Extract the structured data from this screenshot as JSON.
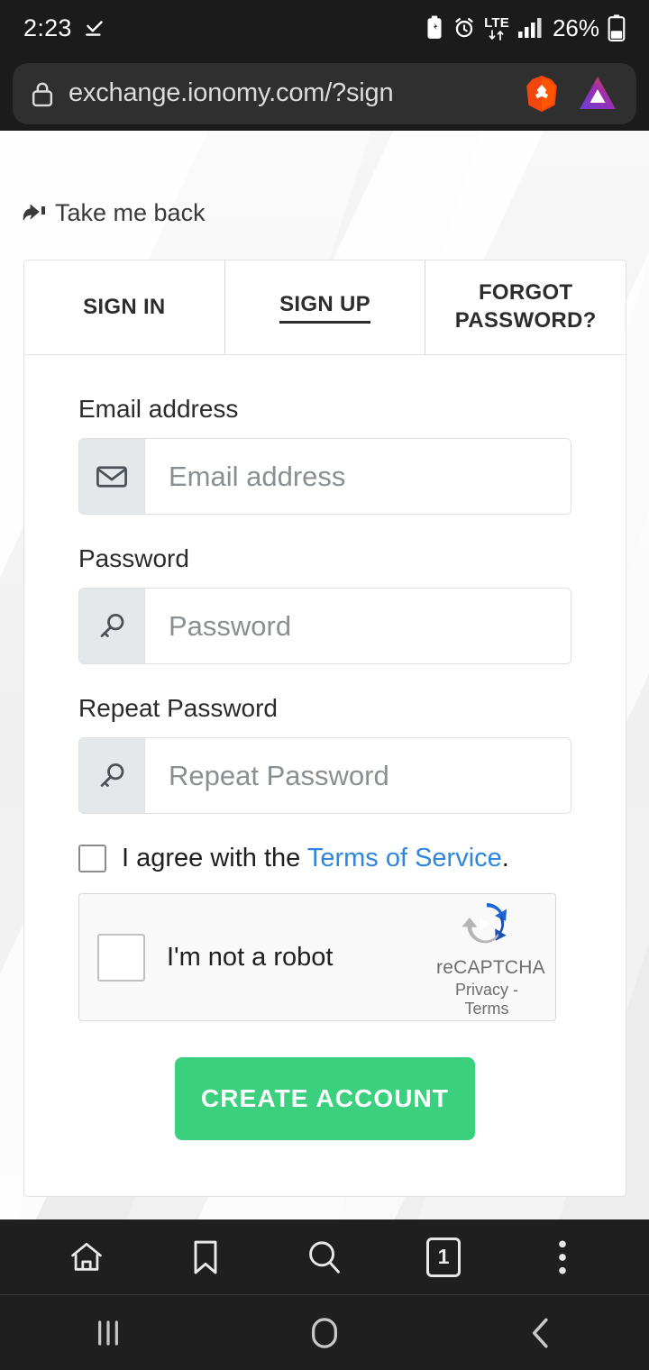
{
  "status_bar": {
    "time": "2:23",
    "battery_percent": "26%",
    "network_type": "LTE",
    "icons": [
      "check-download-icon",
      "battery-saver-icon",
      "alarm-icon",
      "lte-data-icon",
      "signal-bars-icon",
      "battery-icon"
    ]
  },
  "url_bar": {
    "url": "exchange.ionomy.com/?sign",
    "lock_icon": "padlock-icon",
    "brave_icon": "brave-lion-icon",
    "bat_icon": "bat-triangle-icon"
  },
  "page": {
    "take_me_back": "Take me back",
    "back_icon": "reply-arrow-icon",
    "tabs": [
      {
        "label": "SIGN IN",
        "active": false
      },
      {
        "label": "SIGN UP",
        "active": true
      },
      {
        "label": "FORGOT PASSWORD?",
        "active": false
      }
    ],
    "fields": [
      {
        "label": "Email address",
        "placeholder": "Email address",
        "icon": "envelope-icon"
      },
      {
        "label": "Password",
        "placeholder": "Password",
        "icon": "key-icon"
      },
      {
        "label": "Repeat Password",
        "placeholder": "Repeat Password",
        "icon": "key-icon"
      }
    ],
    "agreement": {
      "prefix": "I agree with the ",
      "link": "Terms of Service",
      "suffix": ".",
      "checked": false
    },
    "recaptcha": {
      "label": "I'm not a robot",
      "brand": "reCAPTCHA",
      "legal": "Privacy - Terms",
      "checked": false
    },
    "submit_label": "CREATE ACCOUNT",
    "accent_green": "#3bd07e",
    "link_blue": "#2e86de"
  },
  "browser_toolbar": {
    "home": "home-icon",
    "bookmark": "bookmark-icon",
    "search": "search-icon",
    "tab_count": "1",
    "menu": "more-vertical-icon"
  },
  "android_nav": {
    "recents": "recents-icon",
    "home": "home-circle-icon",
    "back": "back-chevron-icon"
  }
}
